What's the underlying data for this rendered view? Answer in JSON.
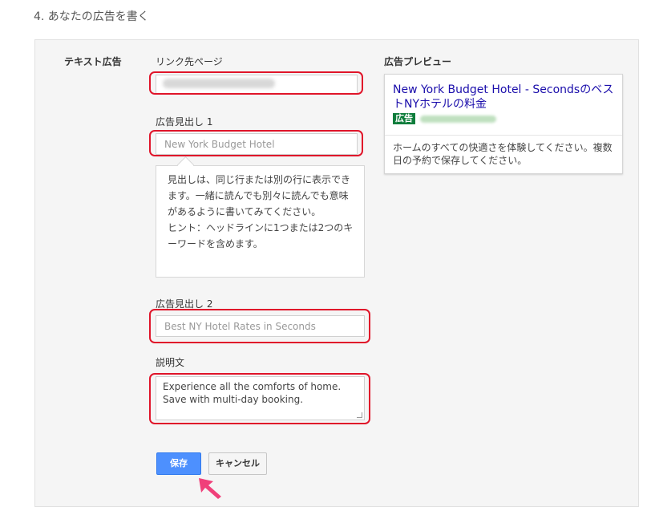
{
  "step_title": "4. あなたの広告を書く",
  "section_label": "テキスト広告",
  "fields": {
    "link_label": "リンク先ページ",
    "headline1_label": "広告見出し 1",
    "headline1_value": "New York Budget Hotel",
    "headline2_label": "広告見出し 2",
    "headline2_value": "Best NY Hotel Rates in Seconds",
    "description_label": "説明文",
    "description_lines": [
      "Experience all the comforts of home.",
      "Save with multi-day booking."
    ]
  },
  "tooltip": {
    "text": "見出しは、同じ行または別の行に表示できます。一緒に読んでも別々に読んでも意味があるように書いてみてください。",
    "hint": "ヒント：ヘッドラインに1つまたは2つのキーワードを含めます。"
  },
  "preview": {
    "label": "広告プレビュー",
    "headline": "New York Budget Hotel - SecondsのベストNYホテルの料金",
    "ad_badge": "広告",
    "description": "ホームのすべての快適さを体験してください。複数日の予約で保存してください。"
  },
  "buttons": {
    "save": "保存",
    "cancel": "キャンセル"
  },
  "colors": {
    "highlight": "#e0152a",
    "save_button": "#4d90fe",
    "link": "#1a0dab",
    "ad_badge": "#0f7d3c",
    "pointer": "#f0407a"
  }
}
